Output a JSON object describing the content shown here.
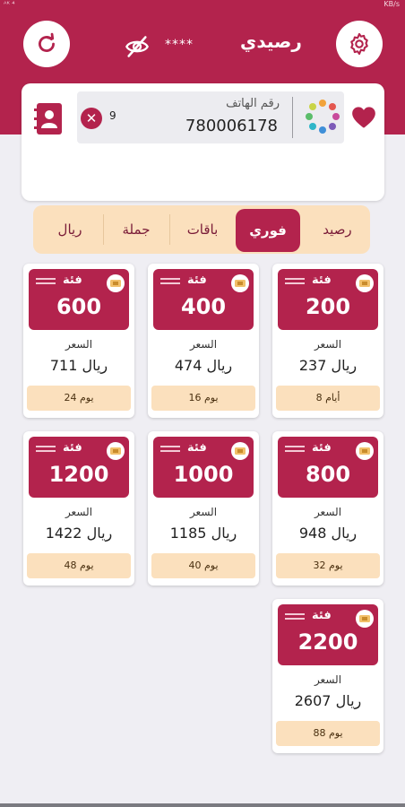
{
  "status_bar": {
    "left": "ᴬᴷ ⁴",
    "right": "KB/s"
  },
  "header": {
    "title": "رصيدي",
    "masked_balance": "****",
    "refresh_icon": "refresh-icon",
    "settings_icon": "gear-icon",
    "visibility_icon": "eye-off-icon",
    "accent_color": "#b3234d"
  },
  "input": {
    "label": "رقم الهاتف",
    "value": "780006178",
    "digit_count": "9",
    "clear_icon": "close-icon",
    "favorite_icon": "heart-icon",
    "contacts_icon": "contacts-icon"
  },
  "tabs": [
    {
      "label": "رصيد",
      "active": false
    },
    {
      "label": "فوري",
      "active": true
    },
    {
      "label": "باقات",
      "active": false
    },
    {
      "label": "جملة",
      "active": false
    },
    {
      "label": "ريال",
      "active": false
    }
  ],
  "cards": [
    {
      "category": "فئة",
      "amount": "200",
      "price_label": "السعر",
      "price": "237 ريال",
      "validity": "8 أيام"
    },
    {
      "category": "فئة",
      "amount": "400",
      "price_label": "السعر",
      "price": "474 ريال",
      "validity": "16 يوم"
    },
    {
      "category": "فئة",
      "amount": "600",
      "price_label": "السعر",
      "price": "711 ريال",
      "validity": "24 يوم"
    },
    {
      "category": "فئة",
      "amount": "800",
      "price_label": "السعر",
      "price": "948 ريال",
      "validity": "32 يوم"
    },
    {
      "category": "فئة",
      "amount": "1000",
      "price_label": "السعر",
      "price": "1185 ريال",
      "validity": "40 يوم"
    },
    {
      "category": "فئة",
      "amount": "1200",
      "price_label": "السعر",
      "price": "1422 ريال",
      "validity": "48 يوم"
    },
    {
      "category": "فئة",
      "amount": "2200",
      "price_label": "السعر",
      "price": "2607 ريال",
      "validity": "88 يوم"
    }
  ]
}
